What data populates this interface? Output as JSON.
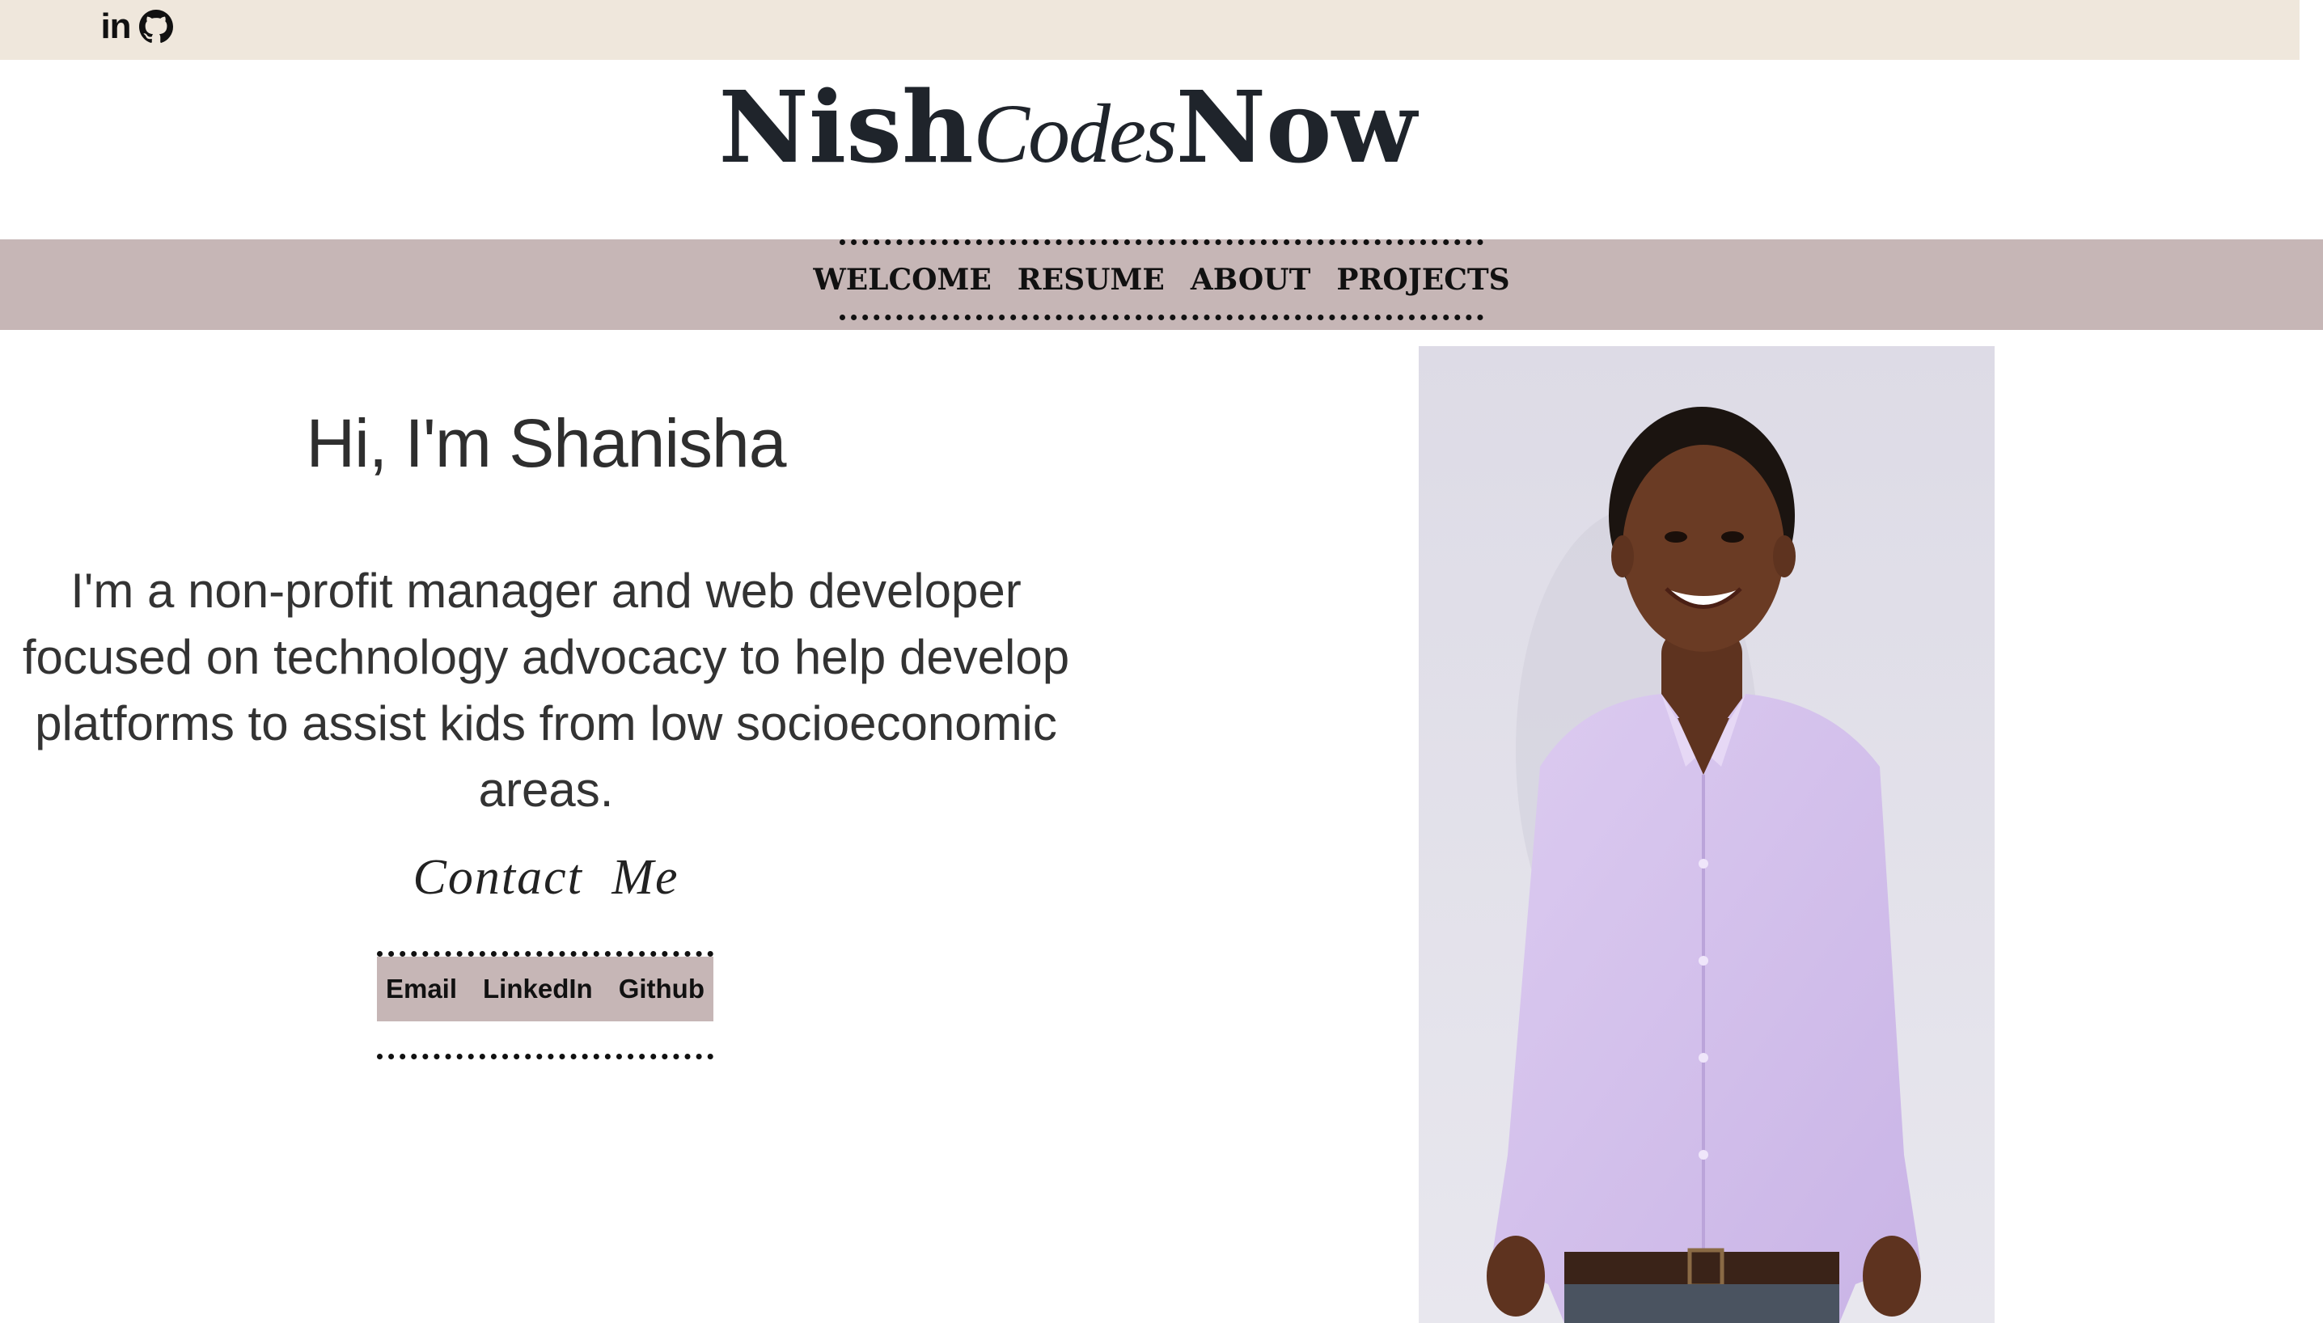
{
  "social": {
    "linkedin_text": "in",
    "linkedin_icon": "linkedin-icon",
    "github_icon": "github-icon"
  },
  "brand": {
    "part1": "Nish",
    "part2": "Codes",
    "part3": "Now"
  },
  "nav": {
    "items": [
      {
        "label": "WELCOME"
      },
      {
        "label": "RESUME"
      },
      {
        "label": "ABOUT"
      },
      {
        "label": "PROJECTS"
      }
    ]
  },
  "hero": {
    "greeting": "Hi, I'm Shanisha",
    "bio": "I'm a non-profit manager and web developer focused on technology advocacy to help develop platforms to assist kids from low socioeconomic areas."
  },
  "contact": {
    "title": "Contact Me",
    "links": [
      {
        "label": "Email"
      },
      {
        "label": "LinkedIn"
      },
      {
        "label": "Github"
      }
    ]
  },
  "photo": {
    "subject": "profile-photo",
    "colors": {
      "background": "#e4e3ea",
      "shirt": "#d9c7ee",
      "skin": "#6a3b24",
      "hair": "#1b1410",
      "belt": "#3a2318",
      "pants": "#4a5360"
    }
  },
  "colors": {
    "topbar": "#efe7dc",
    "navbar": "#c6b6b6",
    "text_dark": "#1f242b"
  }
}
